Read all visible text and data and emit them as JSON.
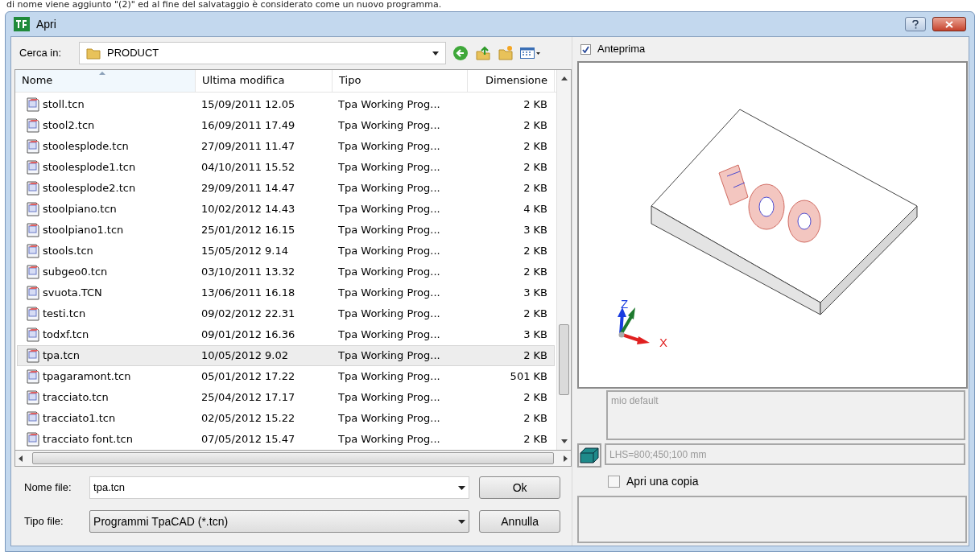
{
  "caption": "di nome viene aggiunto \"(2)\" ed al fine del salvataggio è considerato come un nuovo programma.",
  "window": {
    "title": "Apri"
  },
  "look_in": {
    "label": "Cerca in:",
    "value": "PRODUCT"
  },
  "table": {
    "columns": [
      {
        "label": "Nome",
        "sorted": true
      },
      {
        "label": "Ultima modifica",
        "sorted": false
      },
      {
        "label": "Tipo",
        "sorted": false
      },
      {
        "label": "Dimensione",
        "sorted": false
      }
    ],
    "rows": [
      {
        "name": "stoll.tcn",
        "modified": "15/09/2011 12.05",
        "type": "Tpa Working Prog...",
        "size": "2 KB",
        "selected": false
      },
      {
        "name": "stool2.tcn",
        "modified": "16/09/2011 17.49",
        "type": "Tpa Working Prog...",
        "size": "2 KB",
        "selected": false
      },
      {
        "name": "stoolesplode.tcn",
        "modified": "27/09/2011 11.47",
        "type": "Tpa Working Prog...",
        "size": "2 KB",
        "selected": false
      },
      {
        "name": "stoolesplode1.tcn",
        "modified": "04/10/2011 15.52",
        "type": "Tpa Working Prog...",
        "size": "2 KB",
        "selected": false
      },
      {
        "name": "stoolesplode2.tcn",
        "modified": "29/09/2011 14.47",
        "type": "Tpa Working Prog...",
        "size": "2 KB",
        "selected": false
      },
      {
        "name": "stoolpiano.tcn",
        "modified": "10/02/2012 14.43",
        "type": "Tpa Working Prog...",
        "size": "4 KB",
        "selected": false
      },
      {
        "name": "stoolpiano1.tcn",
        "modified": "25/01/2012 16.15",
        "type": "Tpa Working Prog...",
        "size": "3 KB",
        "selected": false
      },
      {
        "name": "stools.tcn",
        "modified": "15/05/2012 9.14",
        "type": "Tpa Working Prog...",
        "size": "2 KB",
        "selected": false
      },
      {
        "name": "subgeo0.tcn",
        "modified": "03/10/2011 13.32",
        "type": "Tpa Working Prog...",
        "size": "2 KB",
        "selected": false
      },
      {
        "name": "svuota.TCN",
        "modified": "13/06/2011 16.18",
        "type": "Tpa Working Prog...",
        "size": "3 KB",
        "selected": false
      },
      {
        "name": "testi.tcn",
        "modified": "09/02/2012 22.31",
        "type": "Tpa Working Prog...",
        "size": "2 KB",
        "selected": false
      },
      {
        "name": "todxf.tcn",
        "modified": "09/01/2012 16.36",
        "type": "Tpa Working Prog...",
        "size": "3 KB",
        "selected": false
      },
      {
        "name": "tpa.tcn",
        "modified": "10/05/2012 9.02",
        "type": "Tpa Working Prog...",
        "size": "2 KB",
        "selected": true
      },
      {
        "name": "tpagaramont.tcn",
        "modified": "05/01/2012 17.22",
        "type": "Tpa Working Prog...",
        "size": "501 KB",
        "selected": false
      },
      {
        "name": "tracciato.tcn",
        "modified": "25/04/2012 17.17",
        "type": "Tpa Working Prog...",
        "size": "2 KB",
        "selected": false
      },
      {
        "name": "tracciato1.tcn",
        "modified": "02/05/2012 15.22",
        "type": "Tpa Working Prog...",
        "size": "2 KB",
        "selected": false
      },
      {
        "name": "tracciato font.tcn",
        "modified": "07/05/2012 15.47",
        "type": "Tpa Working Prog...",
        "size": "2 KB",
        "selected": false
      }
    ]
  },
  "file_name": {
    "label": "Nome file:",
    "value": "tpa.tcn"
  },
  "file_type": {
    "label": "Tipo file:",
    "value": "Programmi TpaCAD (*.tcn)"
  },
  "buttons": [
    "Ok",
    "Annulla"
  ],
  "preview": {
    "label": "Anteprima",
    "checked": true,
    "axis_z": "Z",
    "axis_x": "X"
  },
  "description": "mio default",
  "dimensions": "LHS=800;450;100 mm",
  "open_copy": {
    "label": "Apri una copia",
    "checked": false
  }
}
